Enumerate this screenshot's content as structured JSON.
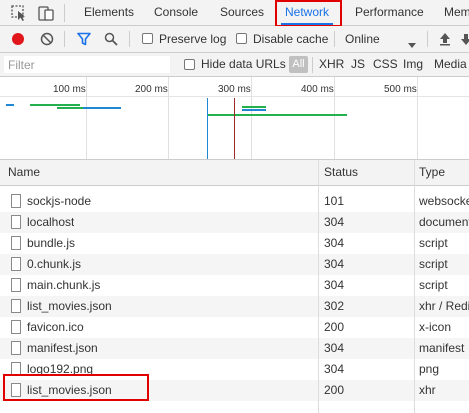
{
  "tabs": [
    {
      "label": "Elements"
    },
    {
      "label": "Console"
    },
    {
      "label": "Sources"
    },
    {
      "label": "Network"
    },
    {
      "label": "Performance"
    },
    {
      "label": "Mem"
    }
  ],
  "active_tab": "Network",
  "toolbar": {
    "preserve_log": "Preserve log",
    "disable_cache": "Disable cache",
    "throttle": "Online"
  },
  "filterbar": {
    "placeholder": "Filter",
    "hide_data_urls": "Hide data URLs",
    "types": [
      "All",
      "XHR",
      "JS",
      "CSS",
      "Img",
      "Media"
    ]
  },
  "overview": {
    "ticks": [
      "100 ms",
      "200 ms",
      "300 ms",
      "400 ms",
      "500 ms"
    ]
  },
  "table": {
    "headers": {
      "name": "Name",
      "status": "Status",
      "type": "Type"
    },
    "rows": [
      {
        "name": "sockjs-node",
        "status": "101",
        "type": "websocket"
      },
      {
        "name": "localhost",
        "status": "304",
        "type": "document"
      },
      {
        "name": "bundle.js",
        "status": "304",
        "type": "script"
      },
      {
        "name": "0.chunk.js",
        "status": "304",
        "type": "script"
      },
      {
        "name": "main.chunk.js",
        "status": "304",
        "type": "script"
      },
      {
        "name": "list_movies.json",
        "status": "302",
        "type": "xhr / Redi"
      },
      {
        "name": "favicon.ico",
        "status": "200",
        "type": "x-icon"
      },
      {
        "name": "manifest.json",
        "status": "304",
        "type": "manifest"
      },
      {
        "name": "logo192.png",
        "status": "304",
        "type": "png"
      },
      {
        "name": "list_movies.json",
        "status": "200",
        "type": "xhr"
      }
    ]
  },
  "colors": {
    "accent": "#1a73e8",
    "record": "#e0161b",
    "highlight_box": "#e10000",
    "bar_blue": "#1e88d2",
    "bar_green": "#22b14c",
    "marker_red": "#9e2b2b"
  }
}
